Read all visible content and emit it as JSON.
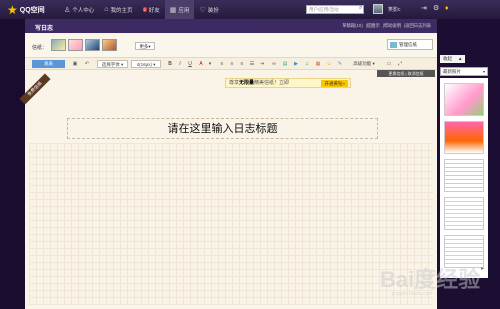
{
  "topbar": {
    "logo": "QQ空间",
    "nav": [
      {
        "label": "个人中心",
        "icon": "person-icon"
      },
      {
        "label": "我的主页",
        "icon": "home-icon"
      },
      {
        "label": "好友",
        "icon": "friends-icon",
        "badge": "2"
      },
      {
        "label": "应用",
        "icon": "apps-icon"
      },
      {
        "label": "装扮",
        "icon": "dressup-icon"
      }
    ],
    "search_placeholder": "用户/应用/活动",
    "user": "笑影c",
    "icons": [
      "search-icon",
      "exit-icon",
      "settings-icon",
      "gem-icon"
    ]
  },
  "editor": {
    "title": "写日志",
    "links": [
      "草稿箱(10)",
      "|提醒示",
      "|帮助说明",
      "|返回日志列表"
    ],
    "letterpaper_label": "信纸：",
    "more": "更多",
    "manage": "管理信纸",
    "publish": "发表",
    "font": "选择字体",
    "size": "4(16px)",
    "advanced": "高级功能",
    "convert": "更换信纸 | 取消信纸",
    "ribbon": "免费信纸",
    "promo_pre": "尊享",
    "promo_bold": "无限量",
    "promo_post": "精美信纸！立即",
    "promo_button": "开通黄钻»",
    "title_placeholder": "请在这里输入日志标题"
  },
  "sidebar": {
    "tabs": [
      "收起",
      "▲"
    ],
    "select": "最新照片",
    "watermark": "Bai度经验",
    "watermark_url": "jingyan.baidu.com"
  }
}
